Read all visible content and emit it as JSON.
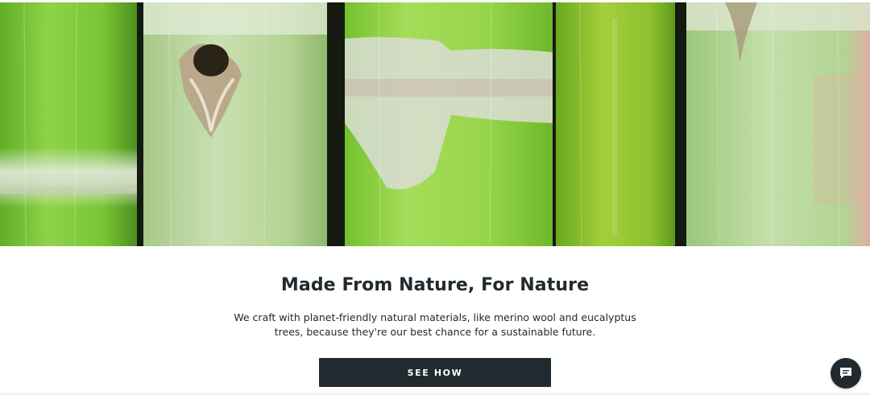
{
  "hero": {
    "image_description_icon": "sugarcane-stalks-image"
  },
  "content": {
    "headline": "Made From Nature, For Nature",
    "body_line_1": "We craft with planet-friendly natural materials, like merino wool and eucalyptus",
    "body_line_2": "trees, because they're our best chance for a sustainable future.",
    "cta_label": "SEE HOW"
  },
  "chat": {
    "icon": "chat-bubble-icon"
  },
  "colors": {
    "text": "#212a2f",
    "button": "#212a2f",
    "background": "#ffffff",
    "stalk_green": "#7cc63a"
  }
}
